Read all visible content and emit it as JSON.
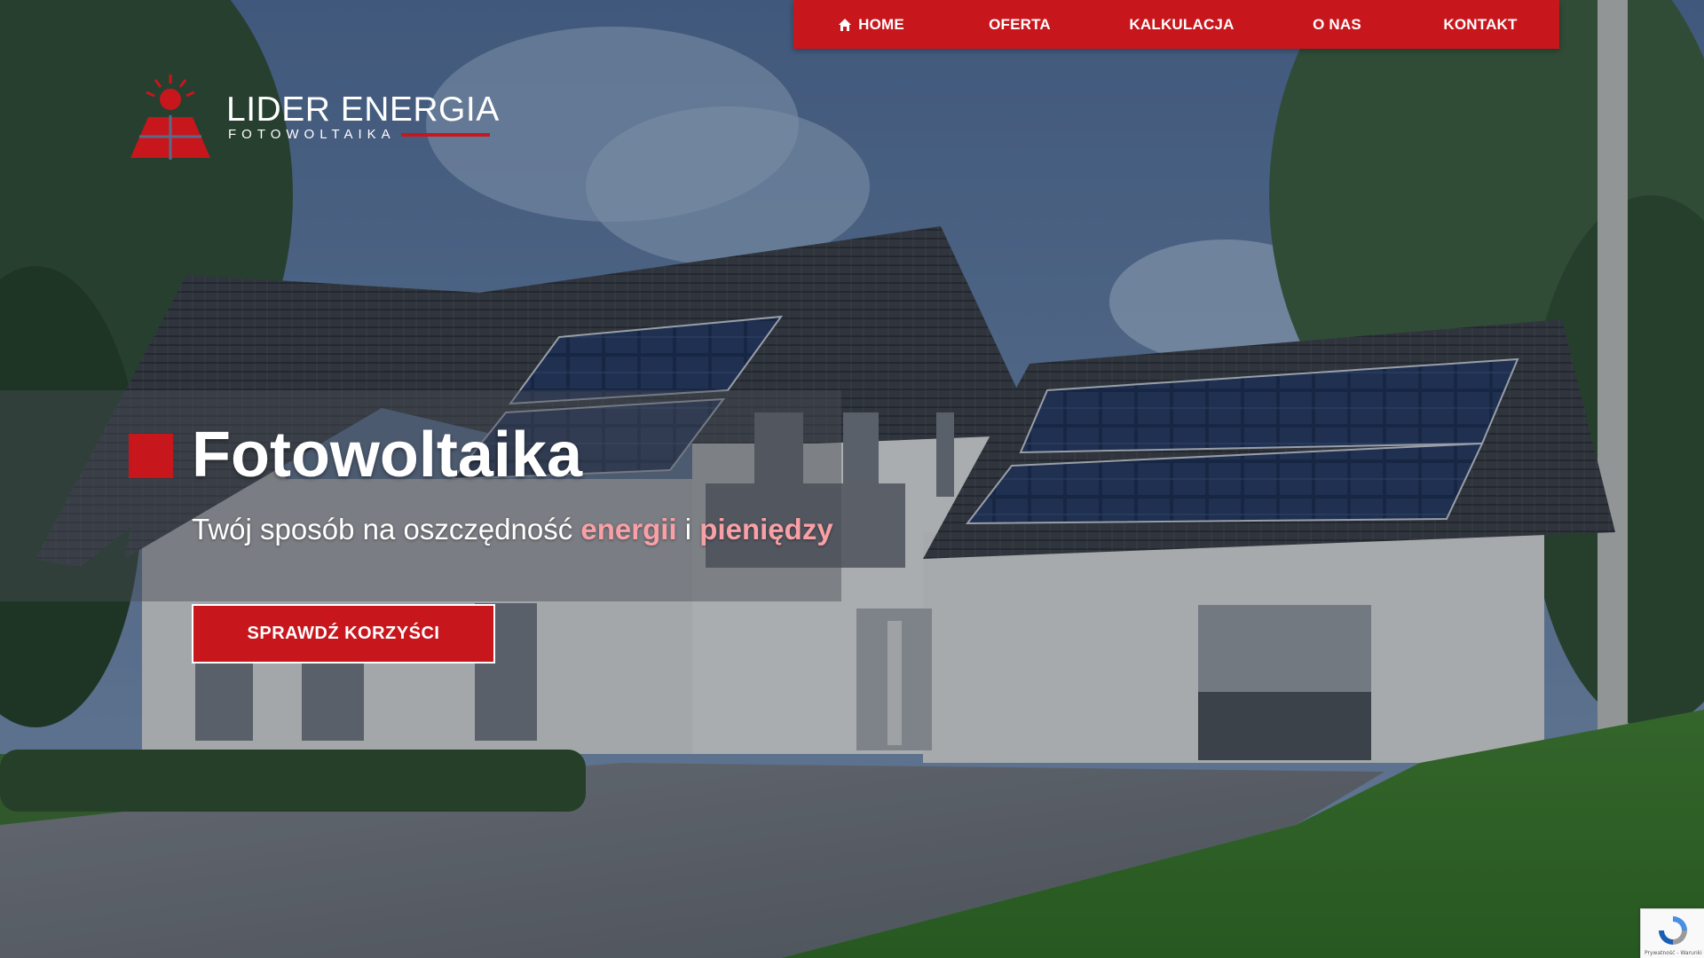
{
  "nav": {
    "items": [
      {
        "label": "HOME",
        "icon": "home-icon"
      },
      {
        "label": "OFERTA"
      },
      {
        "label": "KALKULACJA"
      },
      {
        "label": "O NAS"
      },
      {
        "label": "KONTAKT"
      }
    ],
    "color": "#c8161d"
  },
  "logo": {
    "name": "LIDER ENERGIA",
    "tagline": "FOTOWOLTAIKA"
  },
  "hero": {
    "title": "Fotowoltaika",
    "subtitle_prefix": "Twój sposób na oszczędność ",
    "subtitle_highlight1": "energii",
    "subtitle_mid": " i ",
    "subtitle_highlight2": "pieniędzy",
    "cta_label": "SPRAWDŹ KORZYŚCI"
  },
  "recaptcha": {
    "text": "Prywatność - Warunki"
  }
}
